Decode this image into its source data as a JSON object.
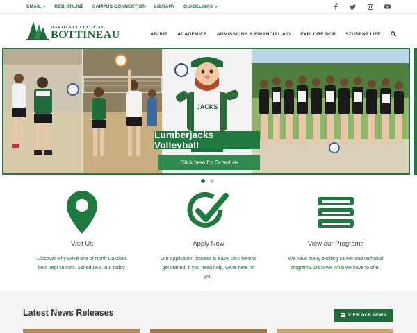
{
  "topbar": {
    "links": [
      {
        "label": "EMAIL",
        "dropdown": true
      },
      {
        "label": "DCB ONLINE",
        "dropdown": false
      },
      {
        "label": "CAMPUS CONNECTION",
        "dropdown": false
      },
      {
        "label": "LIBRARY",
        "dropdown": false
      },
      {
        "label": "QUICKLINKS",
        "dropdown": true
      }
    ],
    "social_icons": [
      "facebook-icon",
      "twitter-icon",
      "instagram-icon",
      "youtube-icon"
    ]
  },
  "logo": {
    "line1": "DAKOTA COLLEGE AT",
    "line2": "BOTTINEAU"
  },
  "nav": {
    "items": [
      "ABOUT",
      "ACADEMICS",
      "ADMISSIONS & FINANCIAL AID",
      "EXPLORE DCB",
      "STUDENT LIFE"
    ],
    "search_icon": "search-icon"
  },
  "hero": {
    "title": "Lumberjacks Volleyball",
    "subtitle": "Click here for Schedule",
    "mascot_shirt": "JACKS",
    "dots": [
      true,
      false
    ]
  },
  "features": [
    {
      "icon": "map-pin-icon",
      "title": "Visit Us",
      "desc": "Discover why we're one of North Dakota's best kept secrets. Schedule a tour today."
    },
    {
      "icon": "check-circle-icon",
      "title": "Apply Now",
      "desc": "Our application process is easy, click here to get started. If you need help, we're here for you."
    },
    {
      "icon": "books-icon",
      "title": "View our Programs",
      "desc": "We have many exciting career and technical programs. Discover what we have to offer."
    }
  ],
  "news": {
    "title": "Latest News Releases",
    "button": "VIEW DCB NEWS"
  },
  "colors": {
    "brand_green": "#1f6b3c",
    "banner_green": "#1f7a3f"
  }
}
